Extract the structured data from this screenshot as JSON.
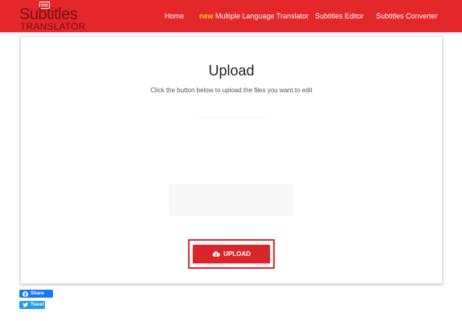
{
  "header": {
    "logo_title": "Subtitles",
    "logo_subtitle": "TRANSLATOR",
    "logo_icon": "subtitle-box-icon",
    "nav": {
      "home": "Home",
      "new_badge": "new",
      "multi_translator": "Multiple Language Translator",
      "subtitles_editor": "Subtitles Editor",
      "subtitles_converter": "Subtitles Converter"
    },
    "colors": {
      "bar": "#e3272b",
      "new_badge": "#ffd21a"
    }
  },
  "main": {
    "title": "Upload",
    "subtitle": "Click the button below to upload the files you want to edit",
    "upload_button": {
      "label": "UPLOAD",
      "icon": "cloud-upload-icon",
      "color": "#d8262a"
    }
  },
  "social": {
    "share_label": "Share",
    "share_icon": "facebook-icon",
    "tweet_label": "Tweet",
    "tweet_icon": "twitter-icon"
  }
}
